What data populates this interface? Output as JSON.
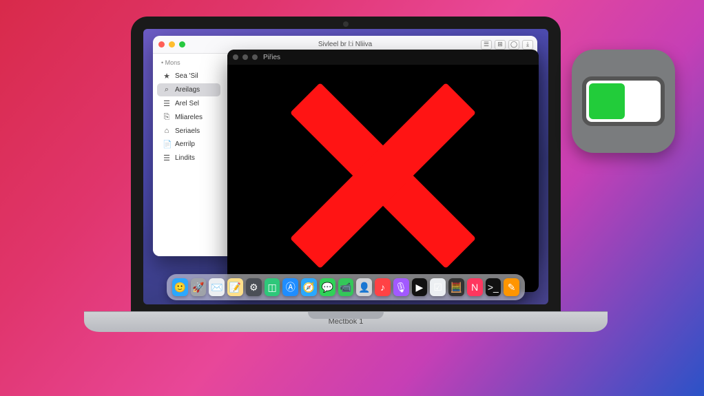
{
  "laptop": {
    "label": "Mectbok 1"
  },
  "finder": {
    "title": "Sivleel br l:i Nliiva",
    "sidebar_header": "Mons",
    "toolbar_icons": [
      "☰",
      "⊞",
      "◯",
      "⤓"
    ],
    "items": [
      {
        "icon": "★",
        "label": "Sea 'Sil"
      },
      {
        "icon": "⌕",
        "label": "Areilags"
      },
      {
        "icon": "☰",
        "label": "Arel Sel"
      },
      {
        "icon": "⎘",
        "label": "Mliareles"
      },
      {
        "icon": "⌂",
        "label": "Seriaels"
      },
      {
        "icon": "📄",
        "label": "Aerrilp"
      },
      {
        "icon": "☰",
        "label": "Lindits"
      }
    ],
    "selected_index": 1
  },
  "darkwin": {
    "title": "Piřies"
  },
  "dock": {
    "icons": [
      {
        "name": "finder-icon",
        "emoji": "🙂",
        "bg": "#2aa8ff"
      },
      {
        "name": "launchpad-icon",
        "emoji": "🚀",
        "bg": "#9fa3a9"
      },
      {
        "name": "mail-icon",
        "emoji": "✉️",
        "bg": "#eceff2"
      },
      {
        "name": "notes-icon",
        "emoji": "📝",
        "bg": "#ffe08a"
      },
      {
        "name": "settings-icon",
        "emoji": "⚙︎",
        "bg": "#4b4f56"
      },
      {
        "name": "widgets-icon",
        "emoji": "◫",
        "bg": "#2ec77a"
      },
      {
        "name": "appstore-icon",
        "emoji": "Ⓐ",
        "bg": "#1f8dff"
      },
      {
        "name": "safari-icon",
        "emoji": "🧭",
        "bg": "#2aa8ff"
      },
      {
        "name": "messages-icon",
        "emoji": "💬",
        "bg": "#30d158"
      },
      {
        "name": "facetime-icon",
        "emoji": "📹",
        "bg": "#34c759"
      },
      {
        "name": "contacts-icon",
        "emoji": "👤",
        "bg": "#d1d3d7"
      },
      {
        "name": "music-icon",
        "emoji": "♪",
        "bg": "#ff4245"
      },
      {
        "name": "podcasts-icon",
        "emoji": "🎙",
        "bg": "#a259ff"
      },
      {
        "name": "tv-icon",
        "emoji": "▶",
        "bg": "#111"
      },
      {
        "name": "reminders-icon",
        "emoji": "☑",
        "bg": "#eceff2"
      },
      {
        "name": "calculator-icon",
        "emoji": "🧮",
        "bg": "#333"
      },
      {
        "name": "news-icon",
        "emoji": "N",
        "bg": "#ff375f"
      },
      {
        "name": "terminal-icon",
        "emoji": ">_",
        "bg": "#111"
      },
      {
        "name": "pages-icon",
        "emoji": "✎",
        "bg": "#ff9500"
      }
    ]
  }
}
